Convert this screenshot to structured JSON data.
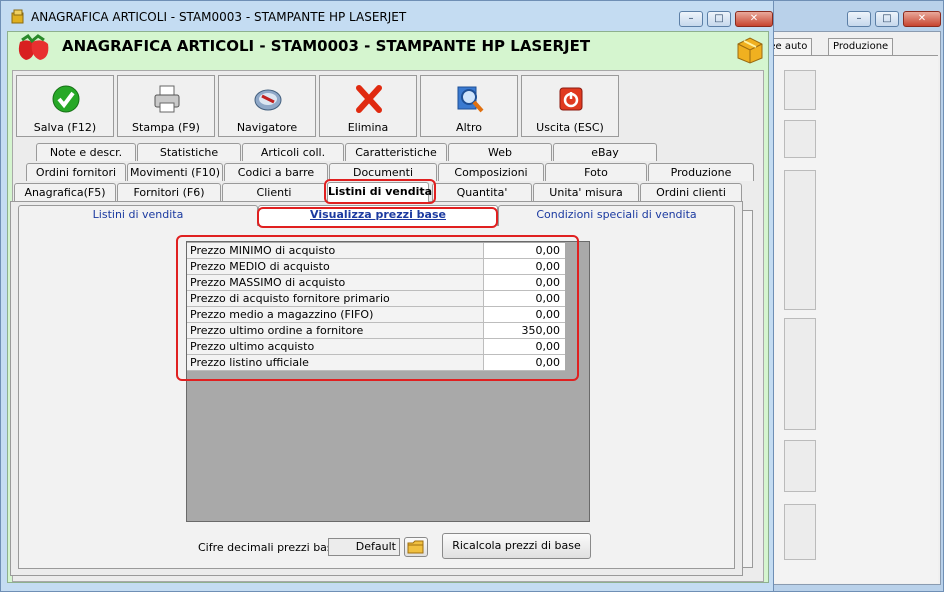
{
  "window": {
    "title": "ANAGRAFICA ARTICOLI - STAM0003 - STAMPANTE HP LASERJET",
    "header": "ANAGRAFICA ARTICOLI - STAM0003 - STAMPANTE HP LASERJET"
  },
  "background_window": {
    "tabs": [
      "nee auto",
      "Produzione"
    ]
  },
  "toolbar": [
    {
      "label": "Salva (F12)",
      "icon": "check-icon"
    },
    {
      "label": "Stampa (F9)",
      "icon": "printer-icon"
    },
    {
      "label": "Navigatore",
      "icon": "compass-icon"
    },
    {
      "label": "Elimina",
      "icon": "delete-x-icon"
    },
    {
      "label": "Altro",
      "icon": "magnifier-icon"
    },
    {
      "label": "Uscita (ESC)",
      "icon": "power-icon"
    }
  ],
  "tabs": {
    "row1": [
      "Note e descr.",
      "Statistiche",
      "Articoli coll.",
      "Caratteristiche",
      "Web",
      "eBay"
    ],
    "row2": [
      "Ordini fornitori",
      "Movimenti (F10)",
      "Codici a barre",
      "Documenti",
      "Composizioni",
      "Foto",
      "Produzione"
    ],
    "row3": [
      "Anagrafica(F5)",
      "Fornitori (F6)",
      "Clienti",
      "Listini di vendita",
      "Quantita'",
      "Unita' misura",
      "Ordini clienti"
    ],
    "active": "Listini di vendita"
  },
  "subtabs": [
    "Listini di vendita",
    "Visualizza prezzi base",
    "Condizioni speciali di vendita"
  ],
  "prices": [
    {
      "label": "Prezzo MINIMO di acquisto",
      "value": "0,00"
    },
    {
      "label": "Prezzo MEDIO di acquisto",
      "value": "0,00"
    },
    {
      "label": "Prezzo MASSIMO di acquisto",
      "value": "0,00"
    },
    {
      "label": "Prezzo di acquisto fornitore primario",
      "value": "0,00"
    },
    {
      "label": "Prezzo medio a magazzino (FIFO)",
      "value": "0,00"
    },
    {
      "label": "Prezzo ultimo ordine a fornitore",
      "value": "350,00"
    },
    {
      "label": "Prezzo ultimo acquisto",
      "value": "0,00"
    },
    {
      "label": "Prezzo listino ufficiale",
      "value": "0,00"
    }
  ],
  "footer": {
    "decimals_label": "Cifre decimali prezzi base :",
    "decimals_value": "Default",
    "recalc_button": "Ricalcola prezzi di base"
  },
  "colors": {
    "highlight": "#e02020",
    "client_green": "#d5f5cf",
    "link_blue": "#1b3aa0"
  }
}
